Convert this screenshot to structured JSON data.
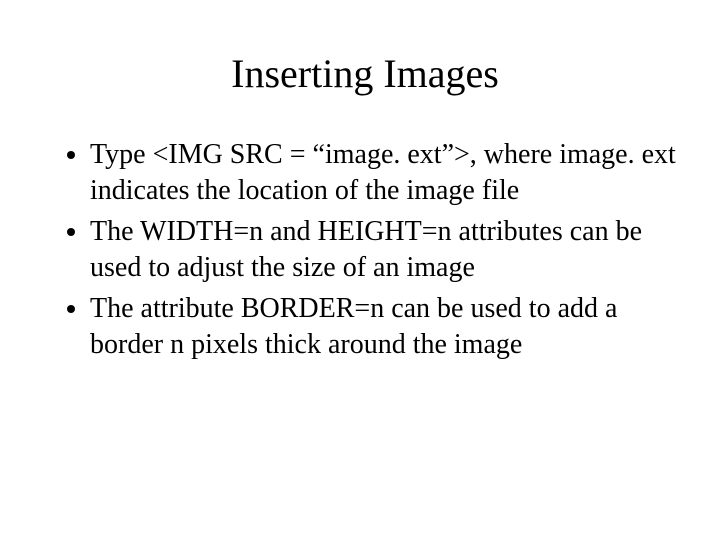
{
  "title": "Inserting Images",
  "bullets": {
    "b1": "Type <IMG SRC = “image. ext”>, where image. ext indicates the location of the image file",
    "b2": "The WIDTH=n and HEIGHT=n attributes can be used to adjust the size of an image",
    "b3": "The attribute BORDER=n can be used to add a border n pixels thick around the image"
  }
}
